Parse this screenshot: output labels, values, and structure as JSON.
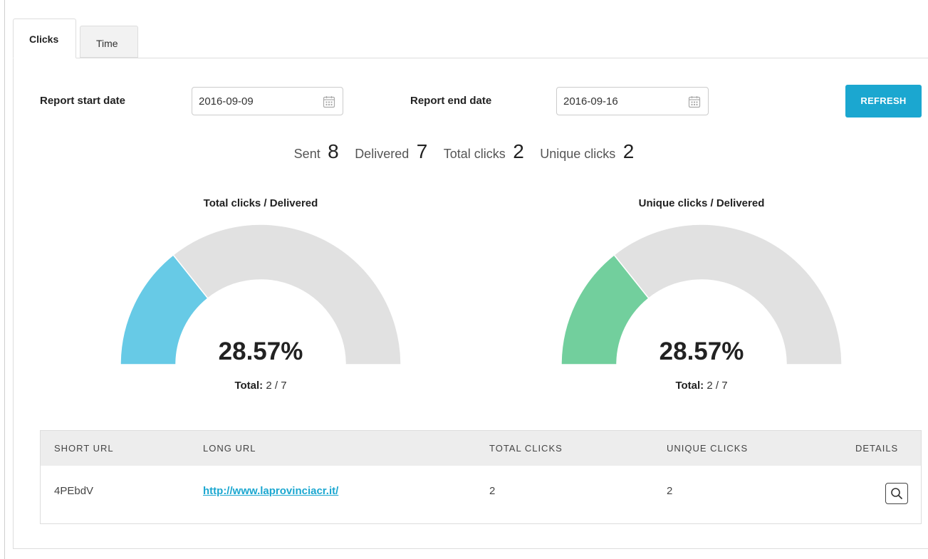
{
  "tabs": [
    {
      "label": "Clicks",
      "active": true
    },
    {
      "label": "Time",
      "active": false
    }
  ],
  "filters": {
    "start_label": "Report start date",
    "start_value": "2016-09-09",
    "end_label": "Report end date",
    "end_value": "2016-09-16",
    "calendar_icon": "calendar-icon",
    "refresh_label": "REFRESH"
  },
  "stats": {
    "sent_label": "Sent",
    "sent_value": "8",
    "delivered_label": "Delivered",
    "delivered_value": "7",
    "total_clicks_label": "Total clicks",
    "total_clicks_value": "2",
    "unique_clicks_label": "Unique clicks",
    "unique_clicks_value": "2"
  },
  "gauges": [
    {
      "title": "Total clicks / Delivered",
      "fraction": 0.2857,
      "percent_text": "28.57%",
      "total_label": "Total:",
      "total_value": "2 / 7",
      "color": "#67cae6",
      "track_color": "#e1e1e1"
    },
    {
      "title": "Unique clicks / Delivered",
      "fraction": 0.2857,
      "percent_text": "28.57%",
      "total_label": "Total:",
      "total_value": "2 / 7",
      "color": "#72cf9d",
      "track_color": "#e1e1e1"
    }
  ],
  "table": {
    "headers": [
      "SHORT URL",
      "LONG URL",
      "TOTAL CLICKS",
      "UNIQUE CLICKS",
      "DETAILS"
    ],
    "rows": [
      {
        "short_url": "4PEbdV",
        "long_url": "http://www.laprovinciacr.it/",
        "total_clicks": "2",
        "unique_clicks": "2",
        "details_icon": "search-icon"
      }
    ]
  },
  "colors": {
    "accent": "#1ba7d0"
  }
}
